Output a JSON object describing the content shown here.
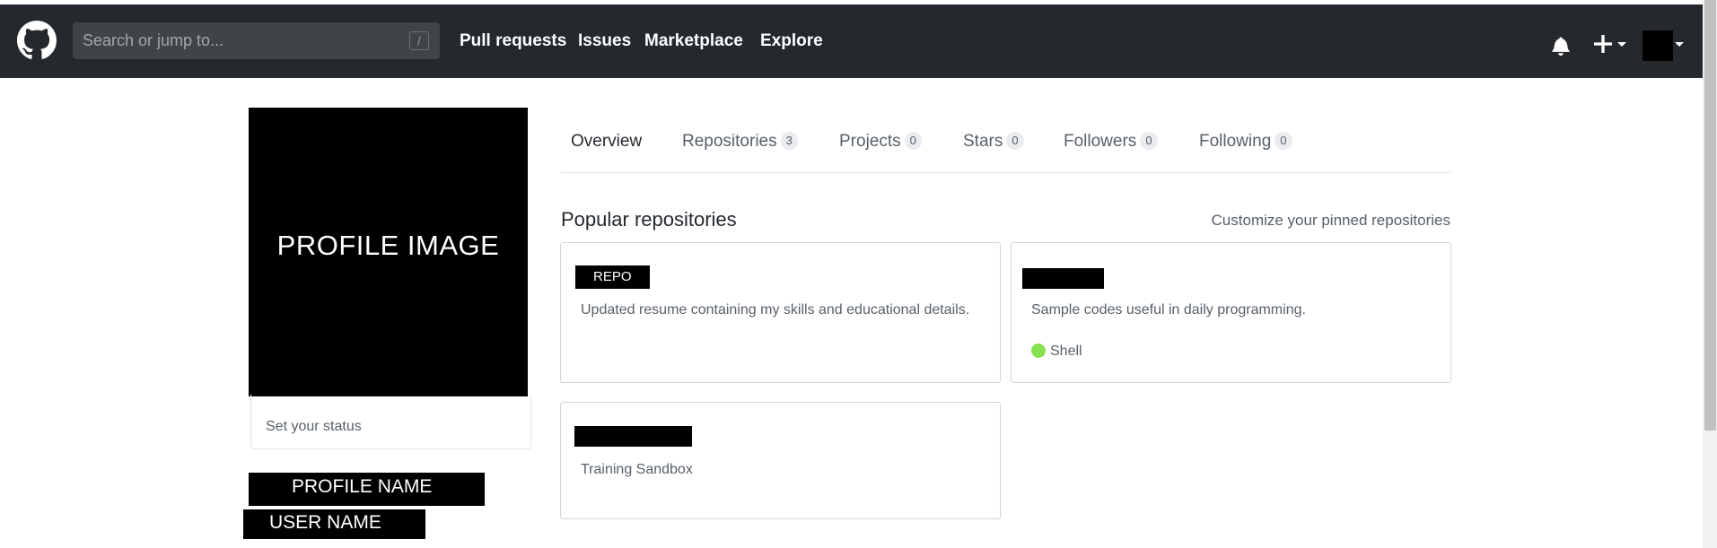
{
  "header": {
    "search_placeholder": "Search or jump to...",
    "search_shortcut": "/",
    "nav": [
      "Pull requests",
      "Issues",
      "Marketplace",
      "Explore"
    ]
  },
  "profile": {
    "image_label": "PROFILE IMAGE",
    "status": "Set your status",
    "name": "PROFILE NAME",
    "username": "USER NAME"
  },
  "tabs": [
    {
      "label": "Overview",
      "count": null
    },
    {
      "label": "Repositories",
      "count": "3"
    },
    {
      "label": "Projects",
      "count": "0"
    },
    {
      "label": "Stars",
      "count": "0"
    },
    {
      "label": "Followers",
      "count": "0"
    },
    {
      "label": "Following",
      "count": "0"
    }
  ],
  "popular": {
    "title": "Popular repositories",
    "customize": "Customize your pinned repositories",
    "repos": [
      {
        "name": "REPO",
        "description": "Updated resume containing my skills and educational details.",
        "language": ""
      },
      {
        "name": "",
        "description": "Sample codes useful in daily programming.",
        "language": "Shell"
      },
      {
        "name": "",
        "description": "Training Sandbox",
        "language": ""
      }
    ]
  },
  "colors": {
    "header_bg": "#24292e",
    "shell_lang": "#89e051"
  }
}
